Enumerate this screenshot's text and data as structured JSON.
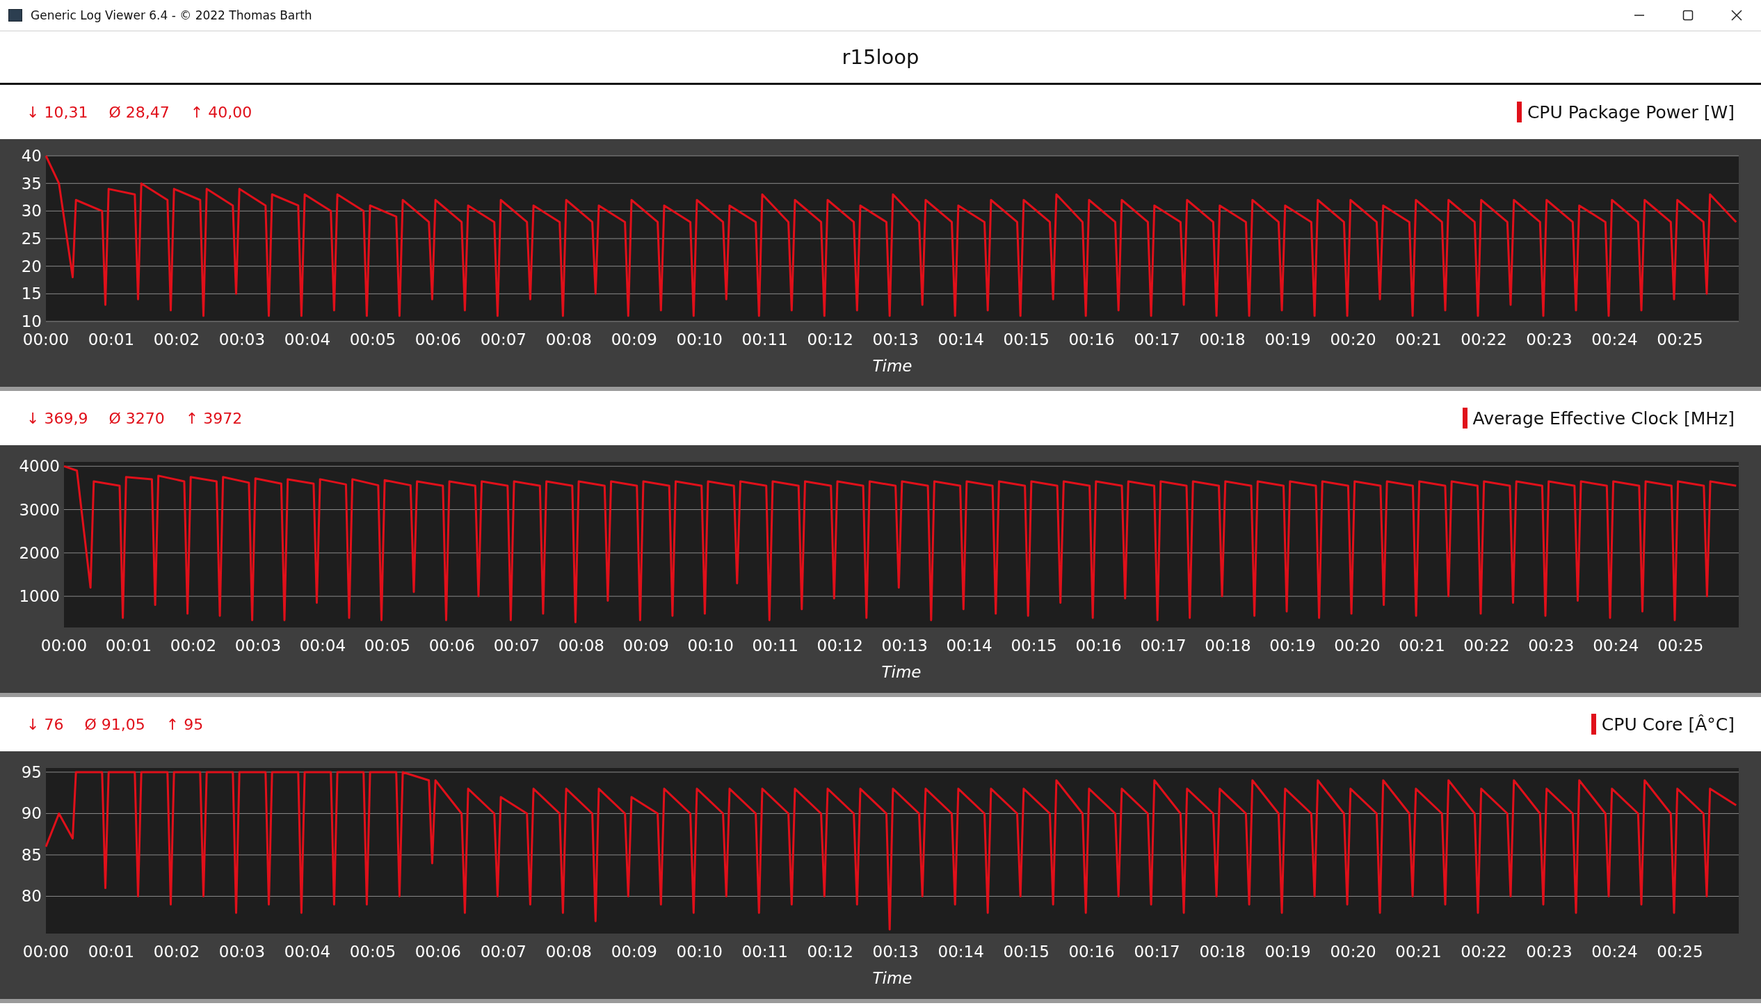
{
  "window": {
    "title": "Generic Log Viewer 6.4 - © 2022 Thomas Barth"
  },
  "title": "r15loop",
  "panels": [
    {
      "min": "↓ 10,31",
      "avg": "Ø 28,47",
      "max": "↑ 40,00",
      "chart_data": {
        "type": "line",
        "grid": true,
        "xlabel": "Time",
        "xlim": [
          0,
          25.9
        ],
        "ylim": [
          10,
          40
        ],
        "yticks": [
          10,
          15,
          20,
          25,
          30,
          35,
          40
        ],
        "xticks": [
          {
            "value": 0,
            "label": "00:00"
          },
          {
            "value": 1,
            "label": "00:01"
          },
          {
            "value": 2,
            "label": "00:02"
          },
          {
            "value": 3,
            "label": "00:03"
          },
          {
            "value": 4,
            "label": "00:04"
          },
          {
            "value": 5,
            "label": "00:05"
          },
          {
            "value": 6,
            "label": "00:06"
          },
          {
            "value": 7,
            "label": "00:07"
          },
          {
            "value": 8,
            "label": "00:08"
          },
          {
            "value": 9,
            "label": "00:09"
          },
          {
            "value": 10,
            "label": "00:10"
          },
          {
            "value": 11,
            "label": "00:11"
          },
          {
            "value": 12,
            "label": "00:12"
          },
          {
            "value": 13,
            "label": "00:13"
          },
          {
            "value": 14,
            "label": "00:14"
          },
          {
            "value": 15,
            "label": "00:15"
          },
          {
            "value": 16,
            "label": "00:16"
          },
          {
            "value": 17,
            "label": "00:17"
          },
          {
            "value": 18,
            "label": "00:18"
          },
          {
            "value": 19,
            "label": "00:19"
          },
          {
            "value": 20,
            "label": "00:20"
          },
          {
            "value": 21,
            "label": "00:21"
          },
          {
            "value": 22,
            "label": "00:22"
          },
          {
            "value": 23,
            "label": "00:23"
          },
          {
            "value": 24,
            "label": "00:24"
          },
          {
            "value": 25,
            "label": "00:25"
          }
        ],
        "x": [
          0,
          0.2,
          0.41,
          0.46,
          0.86,
          0.91,
          0.96,
          1.36,
          1.41,
          1.46,
          1.86,
          1.91,
          1.96,
          2.36,
          2.41,
          2.46,
          2.86,
          2.91,
          2.96,
          3.36,
          3.41,
          3.46,
          3.86,
          3.91,
          3.96,
          4.36,
          4.41,
          4.46,
          4.86,
          4.91,
          4.96,
          5.36,
          5.41,
          5.46,
          5.86,
          5.91,
          5.96,
          6.36,
          6.41,
          6.46,
          6.86,
          6.91,
          6.96,
          7.36,
          7.41,
          7.46,
          7.86,
          7.91,
          7.96,
          8.36,
          8.41,
          8.46,
          8.86,
          8.91,
          8.96,
          9.36,
          9.41,
          9.46,
          9.86,
          9.91,
          9.96,
          10.36,
          10.41,
          10.46,
          10.86,
          10.91,
          10.96,
          11.36,
          11.41,
          11.46,
          11.86,
          11.91,
          11.96,
          12.36,
          12.41,
          12.46,
          12.86,
          12.91,
          12.96,
          13.36,
          13.41,
          13.46,
          13.86,
          13.91,
          13.96,
          14.36,
          14.41,
          14.46,
          14.86,
          14.91,
          14.96,
          15.36,
          15.41,
          15.46,
          15.86,
          15.91,
          15.96,
          16.36,
          16.41,
          16.46,
          16.86,
          16.91,
          16.96,
          17.36,
          17.41,
          17.46,
          17.86,
          17.91,
          17.96,
          18.36,
          18.41,
          18.46,
          18.86,
          18.91,
          18.96,
          19.36,
          19.41,
          19.46,
          19.86,
          19.91,
          19.96,
          20.36,
          20.41,
          20.46,
          20.86,
          20.91,
          20.96,
          21.36,
          21.41,
          21.46,
          21.86,
          21.91,
          21.96,
          22.36,
          22.41,
          22.46,
          22.86,
          22.91,
          22.96,
          23.36,
          23.41,
          23.46,
          23.86,
          23.91,
          23.96,
          24.36,
          24.41,
          24.46,
          24.86,
          24.91,
          24.96,
          25.36,
          25.41,
          25.46,
          25.86
        ],
        "series": [
          {
            "name": "CPU Package Power [W]",
            "color": "#e0101a",
            "values": [
              40,
              35,
              18,
              32,
              30,
              13,
              34,
              33,
              14,
              35,
              32,
              12,
              34,
              32,
              11,
              34,
              31,
              15,
              34,
              31,
              11,
              33,
              31,
              11,
              33,
              30,
              12,
              33,
              30,
              11,
              31,
              29,
              11,
              32,
              28,
              14,
              32,
              28,
              12,
              31,
              28,
              11,
              32,
              28,
              14,
              31,
              28,
              11,
              32,
              28,
              15,
              31,
              28,
              11,
              32,
              28,
              12,
              31,
              28,
              11,
              32,
              28,
              14,
              31,
              28,
              11,
              33,
              28,
              12,
              32,
              28,
              11,
              32,
              28,
              12,
              31,
              28,
              11,
              33,
              28,
              13,
              32,
              28,
              11,
              31,
              28,
              12,
              32,
              28,
              11,
              32,
              28,
              14,
              33,
              28,
              11,
              32,
              28,
              12,
              32,
              28,
              11,
              31,
              28,
              13,
              32,
              28,
              11,
              31,
              28,
              11,
              32,
              28,
              12,
              31,
              28,
              11,
              32,
              28,
              11,
              32,
              28,
              14,
              31,
              28,
              11,
              32,
              28,
              12,
              32,
              28,
              11,
              32,
              28,
              13,
              32,
              28,
              11,
              32,
              28,
              12,
              31,
              28,
              11,
              32,
              28,
              12,
              32,
              28,
              14,
              32,
              28,
              15,
              33,
              28
            ]
          }
        ]
      }
    },
    {
      "min": "↓ 369,9",
      "avg": "Ø 3270",
      "max": "↑ 3972",
      "chart_data": {
        "type": "line",
        "grid": true,
        "xlabel": "Time",
        "xlim": [
          0,
          25.9
        ],
        "ylim": [
          280,
          4100
        ],
        "yticks": [
          1000,
          2000,
          3000,
          4000
        ],
        "xticks": [
          {
            "value": 0,
            "label": "00:00"
          },
          {
            "value": 1,
            "label": "00:01"
          },
          {
            "value": 2,
            "label": "00:02"
          },
          {
            "value": 3,
            "label": "00:03"
          },
          {
            "value": 4,
            "label": "00:04"
          },
          {
            "value": 5,
            "label": "00:05"
          },
          {
            "value": 6,
            "label": "00:06"
          },
          {
            "value": 7,
            "label": "00:07"
          },
          {
            "value": 8,
            "label": "00:08"
          },
          {
            "value": 9,
            "label": "00:09"
          },
          {
            "value": 10,
            "label": "00:10"
          },
          {
            "value": 11,
            "label": "00:11"
          },
          {
            "value": 12,
            "label": "00:12"
          },
          {
            "value": 13,
            "label": "00:13"
          },
          {
            "value": 14,
            "label": "00:14"
          },
          {
            "value": 15,
            "label": "00:15"
          },
          {
            "value": 16,
            "label": "00:16"
          },
          {
            "value": 17,
            "label": "00:17"
          },
          {
            "value": 18,
            "label": "00:18"
          },
          {
            "value": 19,
            "label": "00:19"
          },
          {
            "value": 20,
            "label": "00:20"
          },
          {
            "value": 21,
            "label": "00:21"
          },
          {
            "value": 22,
            "label": "00:22"
          },
          {
            "value": 23,
            "label": "00:23"
          },
          {
            "value": 24,
            "label": "00:24"
          },
          {
            "value": 25,
            "label": "00:25"
          }
        ],
        "x": [
          0,
          0.2,
          0.41,
          0.46,
          0.86,
          0.91,
          0.96,
          1.36,
          1.41,
          1.46,
          1.86,
          1.91,
          1.96,
          2.36,
          2.41,
          2.46,
          2.86,
          2.91,
          2.96,
          3.36,
          3.41,
          3.46,
          3.86,
          3.91,
          3.96,
          4.36,
          4.41,
          4.46,
          4.86,
          4.91,
          4.96,
          5.36,
          5.41,
          5.46,
          5.86,
          5.91,
          5.96,
          6.36,
          6.41,
          6.46,
          6.86,
          6.91,
          6.96,
          7.36,
          7.41,
          7.46,
          7.86,
          7.91,
          7.96,
          8.36,
          8.41,
          8.46,
          8.86,
          8.91,
          8.96,
          9.36,
          9.41,
          9.46,
          9.86,
          9.91,
          9.96,
          10.36,
          10.41,
          10.46,
          10.86,
          10.91,
          10.96,
          11.36,
          11.41,
          11.46,
          11.86,
          11.91,
          11.96,
          12.36,
          12.41,
          12.46,
          12.86,
          12.91,
          12.96,
          13.36,
          13.41,
          13.46,
          13.86,
          13.91,
          13.96,
          14.36,
          14.41,
          14.46,
          14.86,
          14.91,
          14.96,
          15.36,
          15.41,
          15.46,
          15.86,
          15.91,
          15.96,
          16.36,
          16.41,
          16.46,
          16.86,
          16.91,
          16.96,
          17.36,
          17.41,
          17.46,
          17.86,
          17.91,
          17.96,
          18.36,
          18.41,
          18.46,
          18.86,
          18.91,
          18.96,
          19.36,
          19.41,
          19.46,
          19.86,
          19.91,
          19.96,
          20.36,
          20.41,
          20.46,
          20.86,
          20.91,
          20.96,
          21.36,
          21.41,
          21.46,
          21.86,
          21.91,
          21.96,
          22.36,
          22.41,
          22.46,
          22.86,
          22.91,
          22.96,
          23.36,
          23.41,
          23.46,
          23.86,
          23.91,
          23.96,
          24.36,
          24.41,
          24.46,
          24.86,
          24.91,
          24.96,
          25.36,
          25.41,
          25.46,
          25.86
        ],
        "series": [
          {
            "name": "Average Effective Clock [MHz]",
            "color": "#e0101a",
            "values": [
              4000,
              3900,
              1200,
              3650,
              3550,
              500,
              3750,
              3700,
              800,
              3780,
              3650,
              600,
              3750,
              3650,
              550,
              3750,
              3620,
              450,
              3720,
              3600,
              450,
              3700,
              3600,
              850,
              3700,
              3580,
              500,
              3700,
              3560,
              450,
              3680,
              3560,
              1100,
              3650,
              3550,
              450,
              3650,
              3550,
              1000,
              3650,
              3550,
              450,
              3650,
              3550,
              600,
              3650,
              3550,
              400,
              3650,
              3550,
              900,
              3650,
              3550,
              450,
              3650,
              3550,
              550,
              3650,
              3550,
              600,
              3650,
              3550,
              1300,
              3650,
              3550,
              450,
              3650,
              3550,
              700,
              3650,
              3550,
              950,
              3650,
              3550,
              500,
              3650,
              3550,
              1200,
              3650,
              3550,
              450,
              3650,
              3550,
              700,
              3650,
              3550,
              600,
              3650,
              3550,
              550,
              3650,
              3550,
              850,
              3650,
              3550,
              500,
              3650,
              3550,
              950,
              3650,
              3550,
              450,
              3650,
              3550,
              500,
              3650,
              3550,
              1000,
              3650,
              3550,
              550,
              3650,
              3550,
              650,
              3650,
              3550,
              500,
              3650,
              3550,
              600,
              3650,
              3550,
              800,
              3650,
              3550,
              550,
              3650,
              3550,
              1000,
              3650,
              3550,
              600,
              3650,
              3550,
              850,
              3650,
              3550,
              550,
              3650,
              3550,
              900,
              3650,
              3550,
              500,
              3650,
              3550,
              650,
              3650,
              3550,
              450,
              3650,
              3550,
              1000,
              3650,
              3550
            ]
          }
        ]
      }
    },
    {
      "min": "↓ 76",
      "avg": "Ø 91,05",
      "max": "↑ 95",
      "chart_data": {
        "type": "line",
        "grid": true,
        "xlabel": "Time",
        "xlim": [
          0,
          25.9
        ],
        "ylim": [
          75.5,
          95.5
        ],
        "yticks": [
          80,
          85,
          90,
          95
        ],
        "xticks": [
          {
            "value": 0,
            "label": "00:00"
          },
          {
            "value": 1,
            "label": "00:01"
          },
          {
            "value": 2,
            "label": "00:02"
          },
          {
            "value": 3,
            "label": "00:03"
          },
          {
            "value": 4,
            "label": "00:04"
          },
          {
            "value": 5,
            "label": "00:05"
          },
          {
            "value": 6,
            "label": "00:06"
          },
          {
            "value": 7,
            "label": "00:07"
          },
          {
            "value": 8,
            "label": "00:08"
          },
          {
            "value": 9,
            "label": "00:09"
          },
          {
            "value": 10,
            "label": "00:10"
          },
          {
            "value": 11,
            "label": "00:11"
          },
          {
            "value": 12,
            "label": "00:12"
          },
          {
            "value": 13,
            "label": "00:13"
          },
          {
            "value": 14,
            "label": "00:14"
          },
          {
            "value": 15,
            "label": "00:15"
          },
          {
            "value": 16,
            "label": "00:16"
          },
          {
            "value": 17,
            "label": "00:17"
          },
          {
            "value": 18,
            "label": "00:18"
          },
          {
            "value": 19,
            "label": "00:19"
          },
          {
            "value": 20,
            "label": "00:20"
          },
          {
            "value": 21,
            "label": "00:21"
          },
          {
            "value": 22,
            "label": "00:22"
          },
          {
            "value": 23,
            "label": "00:23"
          },
          {
            "value": 24,
            "label": "00:24"
          },
          {
            "value": 25,
            "label": "00:25"
          }
        ],
        "x": [
          0,
          0.2,
          0.41,
          0.46,
          0.86,
          0.91,
          0.96,
          1.36,
          1.41,
          1.46,
          1.86,
          1.91,
          1.96,
          2.36,
          2.41,
          2.46,
          2.86,
          2.91,
          2.96,
          3.36,
          3.41,
          3.46,
          3.86,
          3.91,
          3.96,
          4.36,
          4.41,
          4.46,
          4.86,
          4.91,
          4.96,
          5.36,
          5.41,
          5.46,
          5.86,
          5.91,
          5.96,
          6.36,
          6.41,
          6.46,
          6.86,
          6.91,
          6.96,
          7.36,
          7.41,
          7.46,
          7.86,
          7.91,
          7.96,
          8.36,
          8.41,
          8.46,
          8.86,
          8.91,
          8.96,
          9.36,
          9.41,
          9.46,
          9.86,
          9.91,
          9.96,
          10.36,
          10.41,
          10.46,
          10.86,
          10.91,
          10.96,
          11.36,
          11.41,
          11.46,
          11.86,
          11.91,
          11.96,
          12.36,
          12.41,
          12.46,
          12.86,
          12.91,
          12.96,
          13.36,
          13.41,
          13.46,
          13.86,
          13.91,
          13.96,
          14.36,
          14.41,
          14.46,
          14.86,
          14.91,
          14.96,
          15.36,
          15.41,
          15.46,
          15.86,
          15.91,
          15.96,
          16.36,
          16.41,
          16.46,
          16.86,
          16.91,
          16.96,
          17.36,
          17.41,
          17.46,
          17.86,
          17.91,
          17.96,
          18.36,
          18.41,
          18.46,
          18.86,
          18.91,
          18.96,
          19.36,
          19.41,
          19.46,
          19.86,
          19.91,
          19.96,
          20.36,
          20.41,
          20.46,
          20.86,
          20.91,
          20.96,
          21.36,
          21.41,
          21.46,
          21.86,
          21.91,
          21.96,
          22.36,
          22.41,
          22.46,
          22.86,
          22.91,
          22.96,
          23.36,
          23.41,
          23.46,
          23.86,
          23.91,
          23.96,
          24.36,
          24.41,
          24.46,
          24.86,
          24.91,
          24.96,
          25.36,
          25.41,
          25.46,
          25.86
        ],
        "series": [
          {
            "name": "CPU Core [Â°C]",
            "color": "#e0101a",
            "values": [
              86,
              90,
              87,
              95,
              95,
              81,
              95,
              95,
              80,
              95,
              95,
              79,
              95,
              95,
              80,
              95,
              95,
              78,
              95,
              95,
              79,
              95,
              95,
              78,
              95,
              95,
              79,
              95,
              95,
              79,
              95,
              95,
              80,
              95,
              94,
              84,
              94,
              90,
              78,
              93,
              90,
              80,
              92,
              90,
              79,
              93,
              90,
              78,
              93,
              90,
              77,
              93,
              90,
              80,
              92,
              90,
              79,
              93,
              90,
              78,
              93,
              90,
              80,
              93,
              90,
              78,
              93,
              90,
              79,
              93,
              90,
              80,
              93,
              90,
              79,
              93,
              90,
              76,
              93,
              90,
              80,
              93,
              90,
              79,
              93,
              90,
              78,
              93,
              90,
              80,
              93,
              90,
              79,
              94,
              90,
              78,
              93,
              90,
              80,
              93,
              90,
              79,
              94,
              90,
              78,
              93,
              90,
              80,
              93,
              90,
              79,
              94,
              90,
              78,
              93,
              90,
              80,
              94,
              90,
              79,
              93,
              90,
              78,
              94,
              90,
              80,
              93,
              90,
              79,
              94,
              90,
              78,
              93,
              90,
              80,
              94,
              90,
              79,
              93,
              90,
              78,
              94,
              90,
              80,
              93,
              90,
              79,
              94,
              90,
              78,
              93,
              90,
              80,
              93,
              91
            ]
          }
        ]
      }
    }
  ]
}
